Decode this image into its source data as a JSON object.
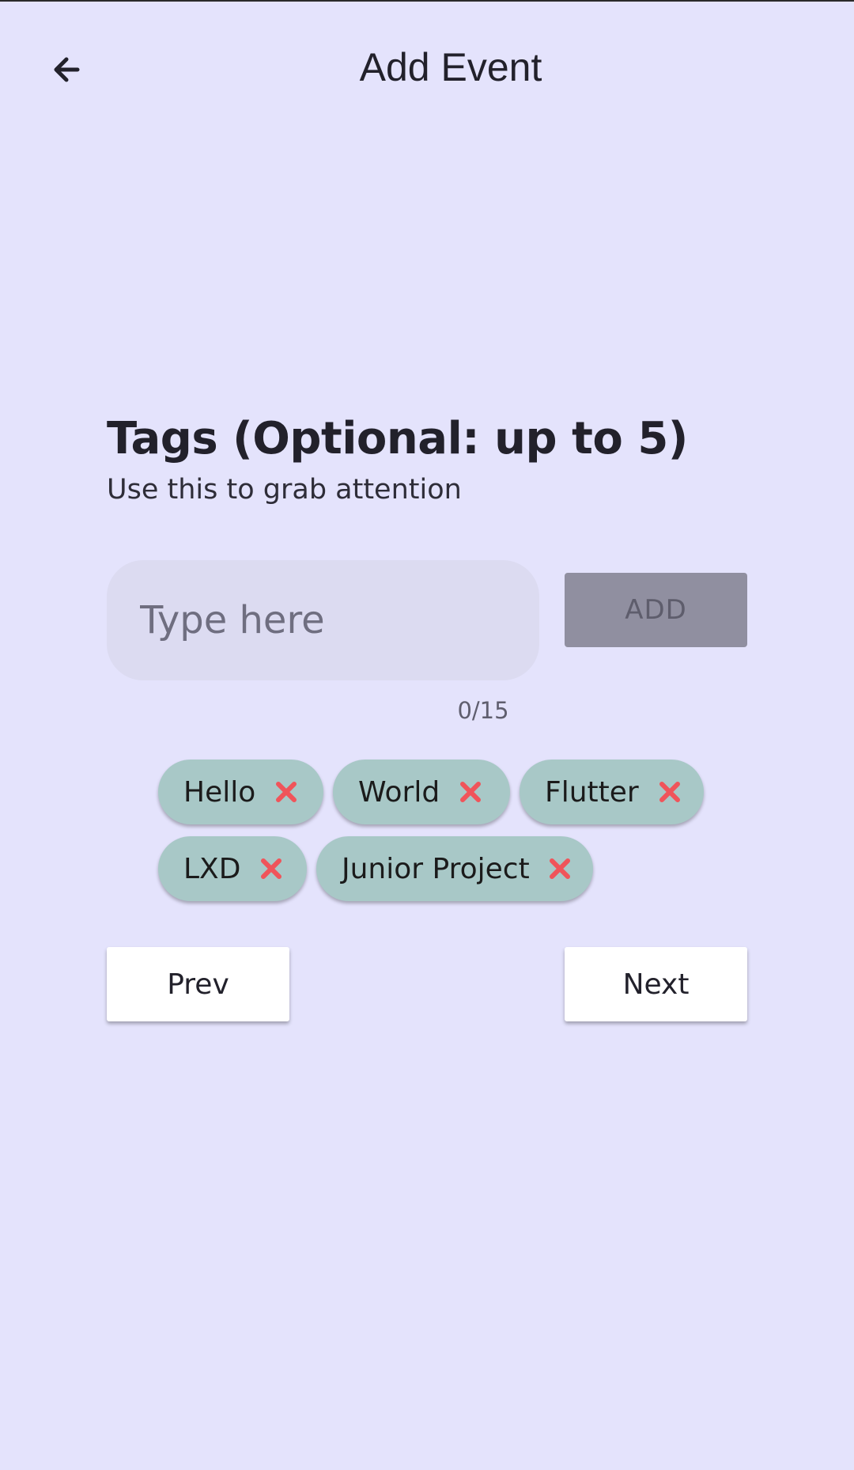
{
  "header": {
    "title": "Add Event",
    "back_icon": "arrow-back-icon"
  },
  "section": {
    "title": "Tags (Optional: up to 5)",
    "subtitle": "Use this to grab attention"
  },
  "input": {
    "value": "",
    "placeholder": "Type here",
    "counter": "0/15"
  },
  "add_button": {
    "label": "ADD"
  },
  "tags": [
    {
      "label": "Hello"
    },
    {
      "label": "World"
    },
    {
      "label": "Flutter"
    },
    {
      "label": "LXD"
    },
    {
      "label": "Junior Project"
    }
  ],
  "navigation": {
    "prev_label": "Prev",
    "next_label": "Next"
  },
  "colors": {
    "background": "#e4e3fc",
    "chip_background": "#a8c8c7",
    "remove_icon": "#f0545a",
    "add_button_disabled": "#908fa0"
  }
}
